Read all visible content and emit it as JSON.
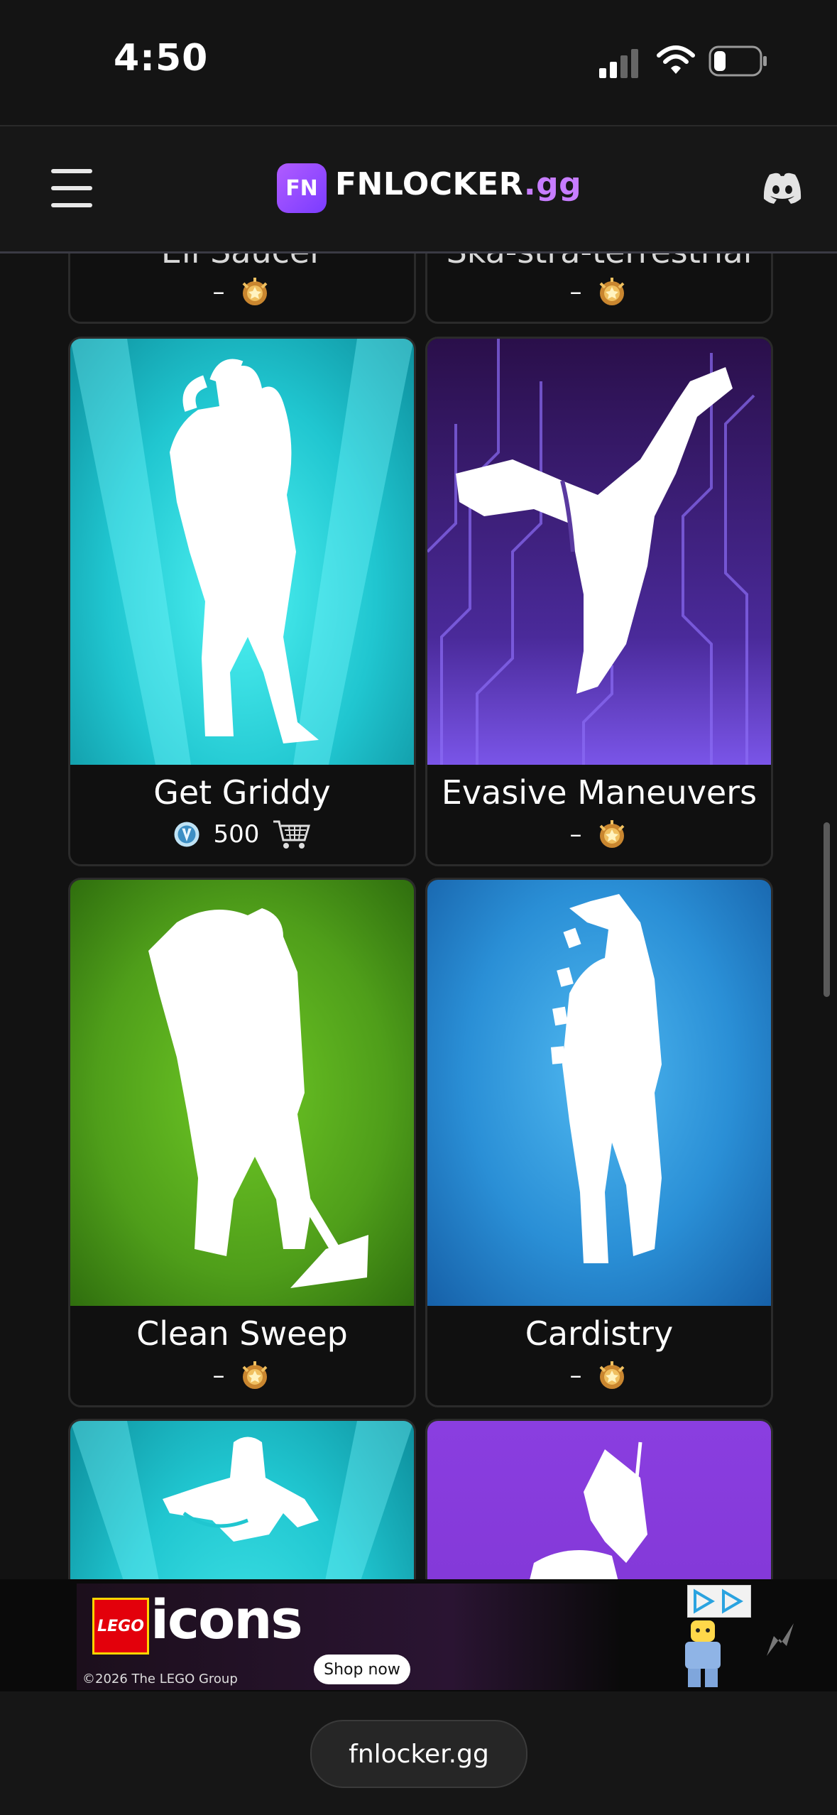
{
  "status_bar": {
    "time": "4:50"
  },
  "nav": {
    "logo_badge": "FN",
    "logo_main": "FNLOCKER",
    "logo_suffix": ".gg"
  },
  "cards": [
    {
      "name": "Eli Saucer",
      "price": "–",
      "price_icon": "battle-pass-icon"
    },
    {
      "name": "Ska-stra-terrestrial",
      "price": "–",
      "price_icon": "battle-pass-icon"
    },
    {
      "name": "Get Griddy",
      "price": "500",
      "price_icon": "vbucks-icon",
      "extra_icon": "cart-icon"
    },
    {
      "name": "Evasive Maneuvers",
      "price": "–",
      "price_icon": "battle-pass-icon"
    },
    {
      "name": "Clean Sweep",
      "price": "–",
      "price_icon": "battle-pass-icon"
    },
    {
      "name": "Cardistry",
      "price": "–",
      "price_icon": "battle-pass-icon"
    }
  ],
  "ad": {
    "brand": "LEGO",
    "headline": "icons",
    "copyright": "©2026 The LEGO Group",
    "cta": "Shop now"
  },
  "browser": {
    "url": "fnlocker.gg"
  },
  "colors": {
    "bg": "#121212",
    "accent": "#c77dff"
  }
}
